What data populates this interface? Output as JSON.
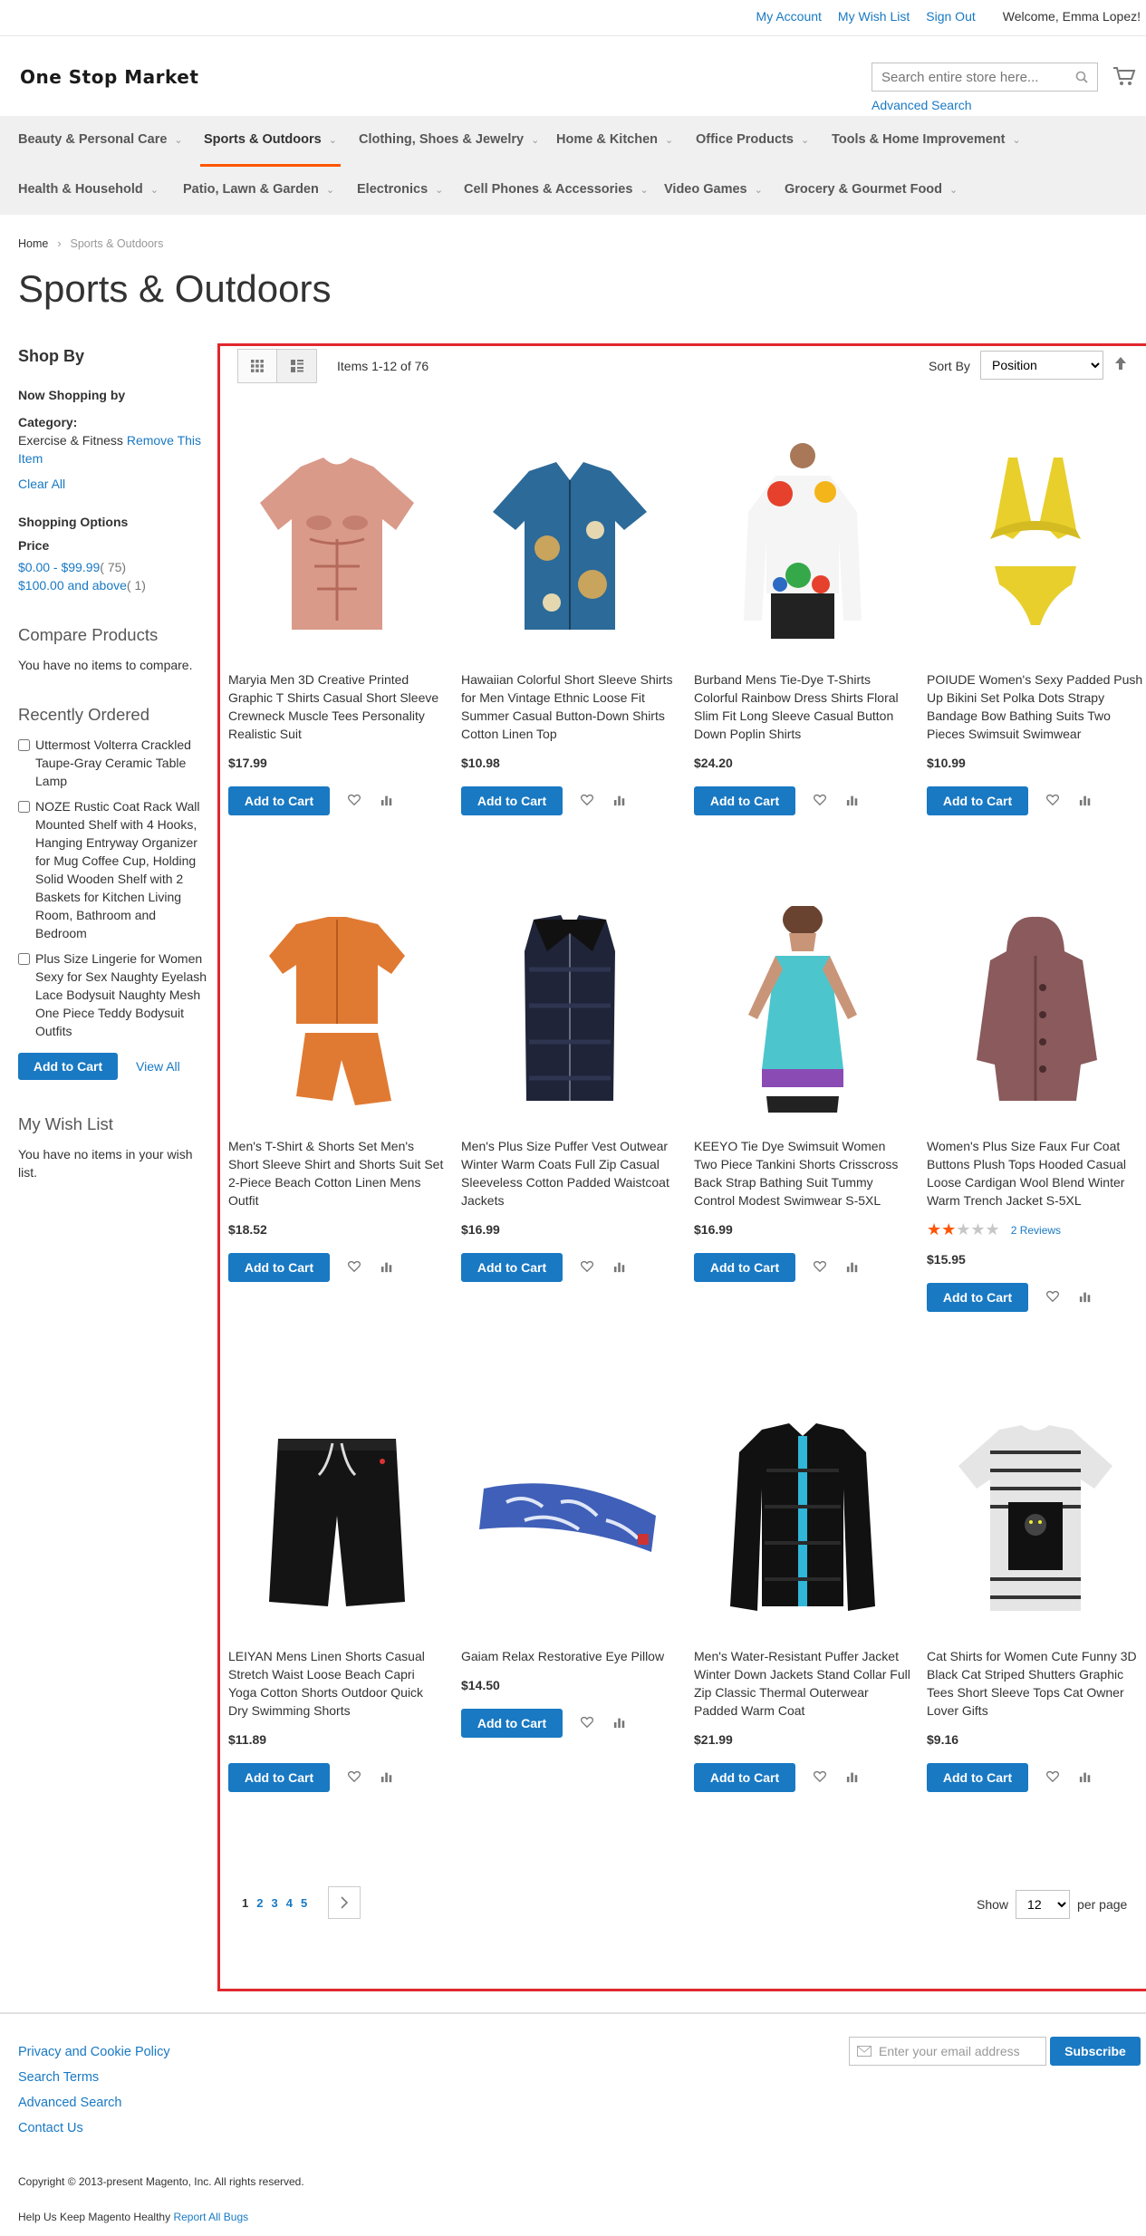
{
  "header": {
    "links": [
      "My Account",
      "My Wish List",
      "Sign Out"
    ],
    "welcome": "Welcome, Emma Lopez!",
    "logo": "One Stop Market",
    "search_placeholder": "Search entire store here...",
    "advanced_search": "Advanced Search"
  },
  "nav": {
    "row1": [
      "Beauty & Personal Care",
      "Sports & Outdoors",
      "Clothing, Shoes & Jewelry",
      "Home & Kitchen",
      "Office Products",
      "Tools & Home Improvement"
    ],
    "row2": [
      "Health & Household",
      "Patio, Lawn & Garden",
      "Electronics",
      "Cell Phones & Accessories",
      "Video Games",
      "Grocery & Gourmet Food"
    ],
    "active": "Sports & Outdoors"
  },
  "breadcrumb": {
    "home": "Home",
    "current": "Sports & Outdoors"
  },
  "page_title": "Sports & Outdoors",
  "sidebar": {
    "shop_by": "Shop By",
    "now_shopping": "Now Shopping by",
    "category_label": "Category:",
    "category_value": "Exercise & Fitness",
    "remove": "Remove This Item",
    "clear_all": "Clear All",
    "shopping_options": "Shopping Options",
    "price_label": "Price",
    "price_ranges": [
      {
        "label": "$0.00 - $99.99",
        "count": "( 75)"
      },
      {
        "label": "$100.00 and above",
        "count": "( 1)"
      }
    ],
    "compare_title": "Compare Products",
    "compare_text": "You have no items to compare.",
    "recent_title": "Recently Ordered",
    "recent_items": [
      "Uttermost Volterra Crackled Taupe-Gray Ceramic Table Lamp",
      "NOZE Rustic Coat Rack Wall Mounted Shelf with 4 Hooks, Hanging Entryway Organizer for Mug Coffee Cup, Holding Solid Wooden Shelf with 2 Baskets for Kitchen Living Room, Bathroom and Bedroom",
      "Plus Size Lingerie for Women Sexy for Sex Naughty Eyelash Lace Bodysuit Naughty Mesh One Piece Teddy Bodysuit Outfits"
    ],
    "add_to_cart": "Add to Cart",
    "view_all": "View All",
    "wishlist_title": "My Wish List",
    "wishlist_text": "You have no items in your wish list."
  },
  "toolbar": {
    "items": "Items 1-12 of 76",
    "sort_label": "Sort By",
    "sort_value": "Position"
  },
  "products": [
    {
      "name": "Maryia Men 3D Creative Printed Graphic T Shirts Casual Short Sleeve Crewneck Muscle Tees Personality Realistic Suit",
      "price": "$17.99",
      "button": "Add to Cart"
    },
    {
      "name": "Hawaiian Colorful Short Sleeve Shirts for Men Vintage Ethnic Loose Fit Summer Casual Button-Down Shirts Cotton Linen Top",
      "price": "$10.98",
      "button": "Add to Cart"
    },
    {
      "name": "Burband Mens Tie-Dye T-Shirts Colorful Rainbow Dress Shirts Floral Slim Fit Long Sleeve Casual Button Down Poplin Shirts",
      "price": "$24.20",
      "button": "Add to Cart"
    },
    {
      "name": "POIUDE Women's Sexy Padded Push Up Bikini Set Polka Dots Strapy Bandage Bow Bathing Suits Two Pieces Swimsuit Swimwear",
      "price": "$10.99",
      "button": "Add to Cart"
    },
    {
      "name": "Men's T-Shirt & Shorts Set Men's Short Sleeve Shirt and Shorts Suit Set 2-Piece Beach Cotton Linen Mens Outfit",
      "price": "$18.52",
      "button": "Add to Cart"
    },
    {
      "name": "Men's Plus Size Puffer Vest Outwear Winter Warm Coats Full Zip Casual Sleeveless Cotton Padded Waistcoat Jackets",
      "price": "$16.99",
      "button": "Add to Cart"
    },
    {
      "name": "KEEYO Tie Dye Swimsuit Women Two Piece Tankini Shorts Crisscross Back Strap Bathing Suit Tummy Control Modest Swimwear S-5XL",
      "price": "$16.99",
      "button": "Add to Cart"
    },
    {
      "name": "Women's Plus Size Faux Fur Coat Buttons Plush Tops Hooded Casual Loose Cardigan Wool Blend Winter Warm Trench Jacket S-5XL",
      "price": "$15.95",
      "button": "Add to Cart",
      "reviews": "2  Reviews",
      "rating": 2
    },
    {
      "name": "LEIYAN Mens Linen Shorts Casual Stretch Waist Loose Beach Capri Yoga Cotton Shorts Outdoor Quick Dry Swimming Shorts",
      "price": "$11.89",
      "button": "Add to Cart"
    },
    {
      "name": "Gaiam Relax Restorative Eye Pillow",
      "price": "$14.50",
      "button": "Add to Cart"
    },
    {
      "name": "Men's Water-Resistant Puffer Jacket Winter Down Jackets Stand Collar Full Zip Classic Thermal Outerwear Padded Warm Coat",
      "price": "$21.99",
      "button": "Add to Cart"
    },
    {
      "name": "Cat Shirts for Women Cute Funny 3D Black Cat Striped Shutters Graphic Tees Short Sleeve Tops Cat Owner Lover Gifts",
      "price": "$9.16",
      "button": "Add to Cart"
    }
  ],
  "pager": {
    "pages": [
      "1",
      "2",
      "3",
      "4",
      "5"
    ],
    "current": "1",
    "show_label": "Show",
    "per_page_value": "12",
    "per_page_label": "per page"
  },
  "footer": {
    "links": [
      "Privacy and Cookie Policy",
      "Search Terms",
      "Advanced Search",
      "Contact Us"
    ],
    "newsletter_placeholder": "Enter your email address",
    "subscribe": "Subscribe",
    "copyright": "Copyright © 2013-present Magento, Inc. All rights reserved.",
    "health_text": "Help Us Keep Magento Healthy",
    "report_bugs": "Report All Bugs"
  },
  "colors": {
    "accent": "#1979c3",
    "nav_active": "#ff5501",
    "highlight_frame": "#e0272d"
  }
}
